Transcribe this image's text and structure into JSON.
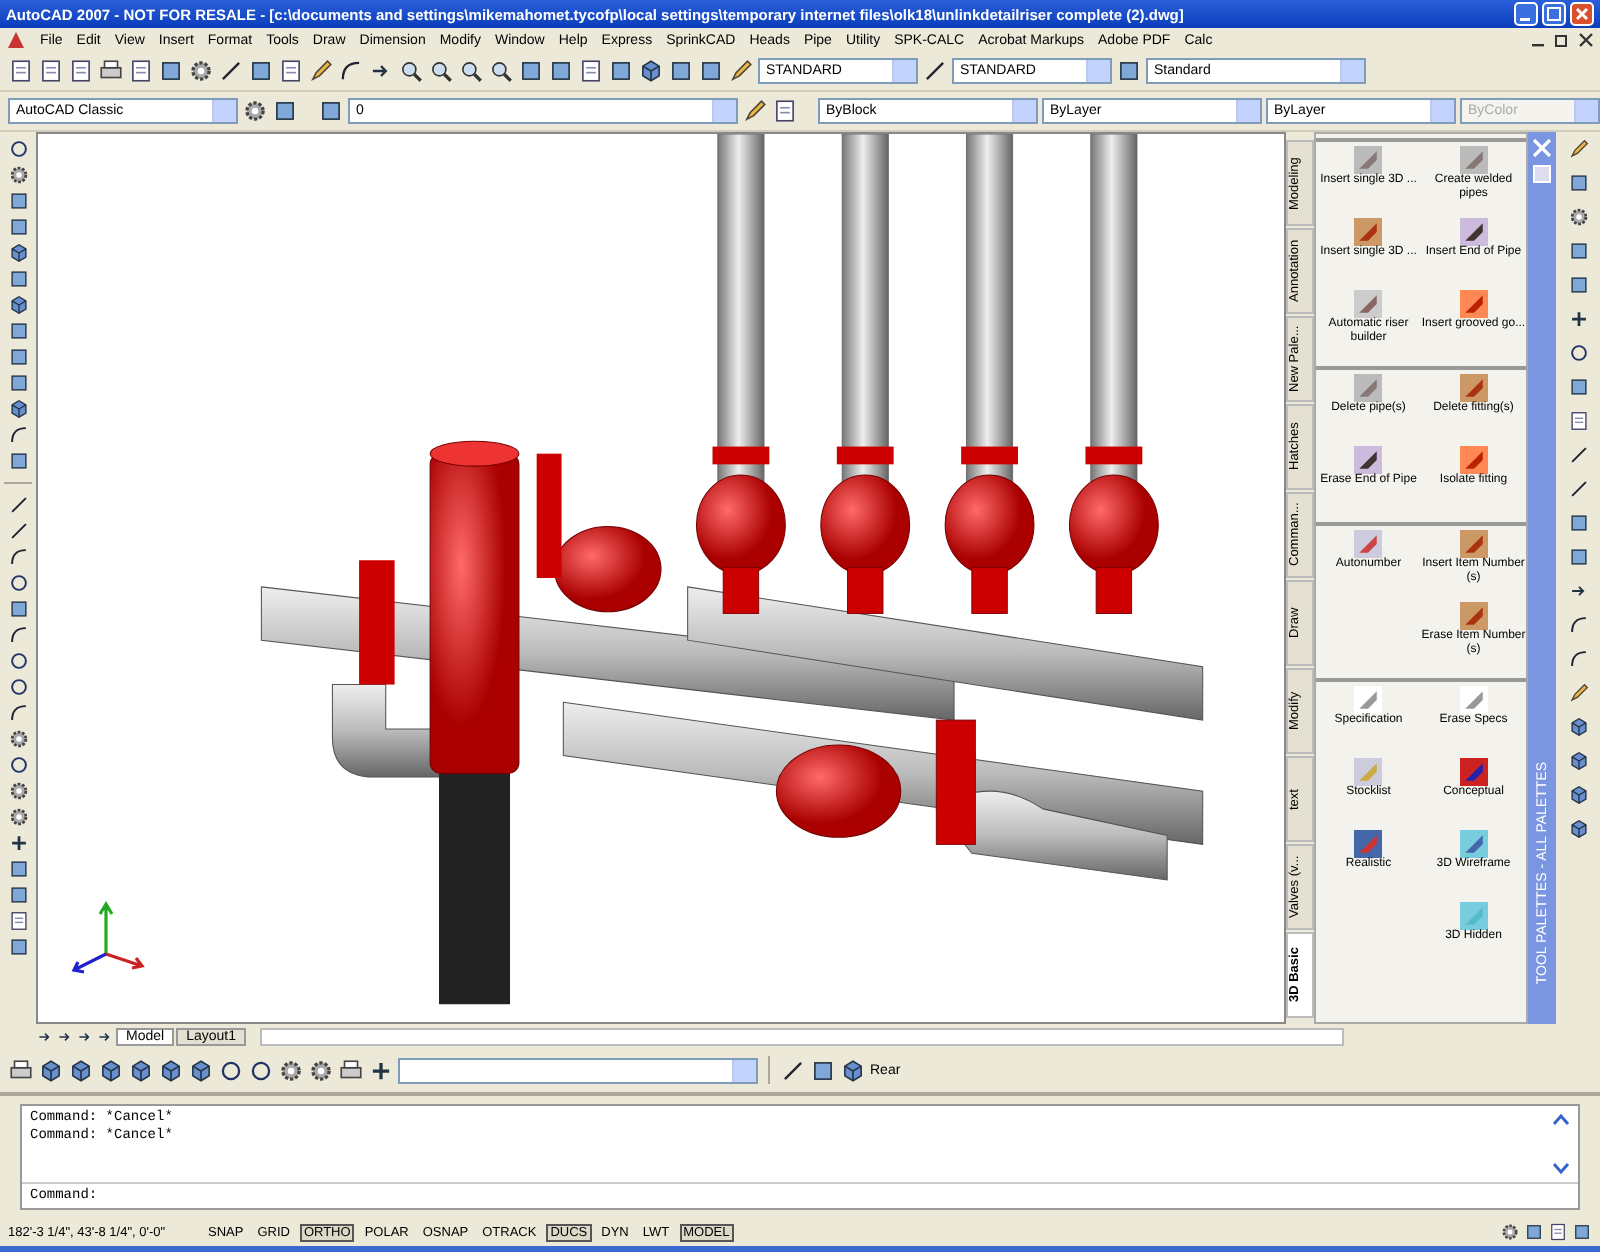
{
  "window": {
    "title": "AutoCAD 2007 - NOT FOR RESALE - [c:\\documents and settings\\mikemahomet.tycofp\\local settings\\temporary internet files\\olk18\\unlinkdetailriser complete (2).dwg]"
  },
  "menu": [
    "File",
    "Edit",
    "View",
    "Insert",
    "Format",
    "Tools",
    "Draw",
    "Dimension",
    "Modify",
    "Window",
    "Help",
    "Express",
    "SprinkCAD",
    "Heads",
    "Pipe",
    "Utility",
    "SPK-CALC",
    "Acrobat Markups",
    "Adobe PDF",
    "Calc"
  ],
  "styles_toolbar": {
    "text_style": "STANDARD",
    "dim_style": "STANDARD",
    "table_style": "Standard"
  },
  "properties_toolbar": {
    "workspace": "AutoCAD Classic",
    "layer": "0",
    "object_color": "ByBlock",
    "linetype": "ByLayer",
    "lineweight": "ByLayer",
    "plot_style": {
      "value": "ByColor",
      "disabled": true
    }
  },
  "palette": {
    "title": "TOOL PALETTES - ALL PALETTES",
    "tabs": [
      {
        "label": "Modeling",
        "selected": false
      },
      {
        "label": "Annotation",
        "selected": false
      },
      {
        "label": "New Pale...",
        "selected": false
      },
      {
        "label": "Hatches",
        "selected": false
      },
      {
        "label": "Comman...",
        "selected": false
      },
      {
        "label": "Draw",
        "selected": false
      },
      {
        "label": "Modify",
        "selected": false
      },
      {
        "label": "text",
        "selected": false
      },
      {
        "label": "Valves (v...",
        "selected": false
      },
      {
        "label": "3D Basic",
        "selected": true
      }
    ],
    "sections": [
      [
        {
          "label": "Insert single 3D ...",
          "kind": "pipe"
        },
        {
          "label": "Create welded pipes",
          "kind": "pipe"
        },
        {
          "label": "Insert single 3D ...",
          "kind": "fitting"
        },
        {
          "label": "Insert End of Pipe",
          "kind": "end"
        },
        {
          "label": "Automatic riser builder",
          "kind": "riser"
        },
        {
          "label": "Insert grooved go...",
          "kind": "coupling"
        }
      ],
      [
        {
          "label": "Delete pipe(s)",
          "kind": "pipe"
        },
        {
          "label": "Delete fitting(s)",
          "kind": "fitting"
        },
        {
          "label": "Erase End of Pipe",
          "kind": "end"
        },
        {
          "label": "Isolate fitting",
          "kind": "coupling"
        }
      ],
      [
        {
          "label": "Autonumber",
          "kind": "number"
        },
        {
          "label": "Insert Item Number (s)",
          "kind": "fitting"
        },
        {
          "kind": "blank"
        },
        {
          "label": "Erase Item Number (s)",
          "kind": "fitting"
        }
      ],
      [
        {
          "label": "Specification",
          "kind": "sheet"
        },
        {
          "label": "Erase Specs",
          "kind": "sheet"
        },
        {
          "label": "Stocklist",
          "kind": "list"
        },
        {
          "label": "Conceptual",
          "kind": "conceptual"
        },
        {
          "label": "Realistic",
          "kind": "realistic"
        },
        {
          "label": "3D Wireframe",
          "kind": "wireframe"
        },
        {
          "kind": "blank"
        },
        {
          "label": "3D Hidden",
          "kind": "hidden"
        }
      ]
    ]
  },
  "layout_tabs": [
    {
      "label": "Model",
      "selected": true
    },
    {
      "label": "Layout1",
      "selected": false
    }
  ],
  "view_toolbar": {
    "view": "Rear"
  },
  "command": {
    "history": [
      "Command:  *Cancel*",
      "Command:  *Cancel*"
    ],
    "prompt": "Command:"
  },
  "status_bar": {
    "coordinates": "182'-3 1/4\", 43'-8 1/4\", 0'-0\"",
    "toggles": [
      {
        "label": "SNAP",
        "on": false
      },
      {
        "label": "GRID",
        "on": false
      },
      {
        "label": "ORTHO",
        "on": true
      },
      {
        "label": "POLAR",
        "on": false
      },
      {
        "label": "OSNAP",
        "on": false
      },
      {
        "label": "OTRACK",
        "on": false
      },
      {
        "label": "DUCS",
        "on": true
      },
      {
        "label": "DYN",
        "on": false
      },
      {
        "label": "LWT",
        "on": false
      },
      {
        "label": "MODEL",
        "on": true
      }
    ]
  }
}
